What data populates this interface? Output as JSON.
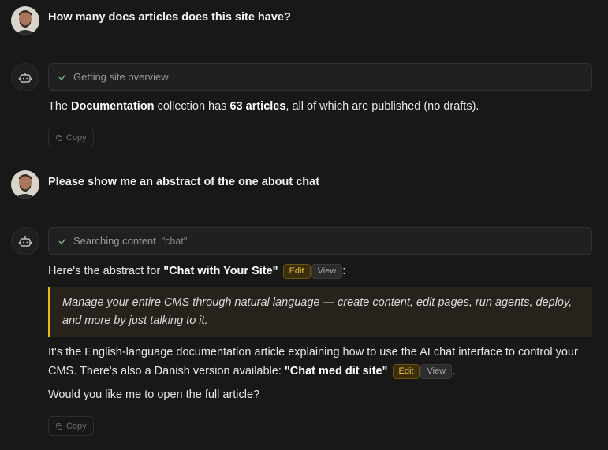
{
  "messages": {
    "q1": "How many docs articles does this site have?",
    "tool1": "Getting site overview",
    "a1": {
      "pre": "The ",
      "collection": "Documentation",
      "mid": " collection has ",
      "count": "63 articles",
      "post": ", all of which are published (no drafts)."
    },
    "copy_label": "Copy",
    "q2": "Please show me an abstract of the one about chat",
    "tool2": "Searching content",
    "tool2_query": "\"chat\"",
    "a2": {
      "intro": "Here's the abstract for ",
      "title": "\"Chat with Your Site\"",
      "colon": ":",
      "quote": "Manage your entire CMS through natural language — create content, edit pages, run agents, deploy, and more by just talking to it.",
      "para": "It's the English-language documentation article explaining how to use the AI chat interface to control your CMS. There's also a Danish version available: ",
      "danish_title": "\"Chat med dit site\"",
      "period": ".",
      "followup": "Would you like me to open the full article?"
    },
    "edit_label": "Edit",
    "view_label": "View"
  },
  "colors": {
    "background": "#181818",
    "accent": "#e8b923"
  }
}
